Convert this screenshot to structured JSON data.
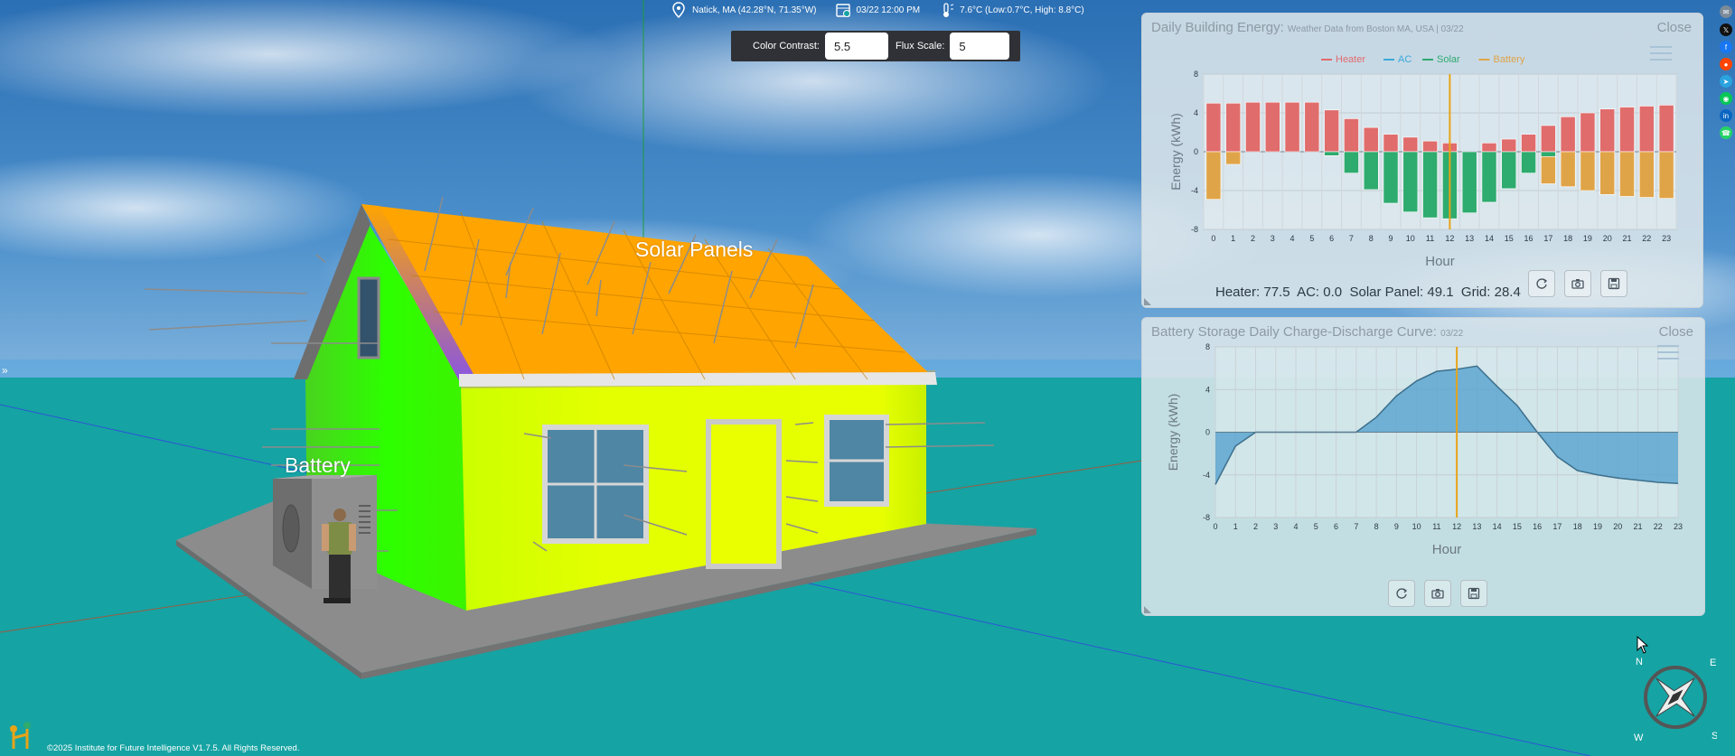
{
  "location": {
    "text": "Natick, MA (42.28°N, 71.35°W)"
  },
  "datetime": {
    "text": "03/22 12:00 PM"
  },
  "weather": {
    "text": "7.6°C (Low:0.7°C, High: 8.8°C)"
  },
  "controls": {
    "color_contrast_label": "Color Contrast:",
    "color_contrast_value": "5.5",
    "flux_scale_label": "Flux Scale:",
    "flux_scale_value": "5"
  },
  "scene_labels": {
    "solar_panels": "Solar Panels",
    "battery": "Battery"
  },
  "sidebar_toggle": "»",
  "energy_panel": {
    "title": "Daily Building Energy:",
    "subtitle": "Weather Data from Boston MA, USA | 03/22",
    "close_label": "Close",
    "summary": {
      "heater_label": "Heater:",
      "heater_value": "77.5",
      "ac_label": "AC:",
      "ac_value": "0.0",
      "solar_label": "Solar Panel:",
      "solar_value": "49.1",
      "grid_label": "Grid:",
      "grid_value": "28.4"
    }
  },
  "battery_panel": {
    "title": "Battery Storage Daily Charge-Discharge Curve:",
    "subtitle": "03/22",
    "close_label": "Close"
  },
  "icons": {
    "location": "map-pin-icon",
    "calendar": "calendar-icon",
    "weather": "thermometer-sun-icon",
    "reload": "reload-icon",
    "camera": "camera-icon",
    "save": "save-icon",
    "menu": "menu-lines-icon"
  },
  "share_links": [
    "email",
    "x",
    "facebook",
    "reddit",
    "telegram",
    "line",
    "linkedin",
    "whatsapp"
  ],
  "compass_letters": {
    "n": "N",
    "e": "E",
    "s": "S",
    "w": "W"
  },
  "footer": {
    "copyright": "©2025 Institute for Future Intelligence V1.7.5. All Rights Reserved."
  },
  "colors": {
    "heater": "#e06c6c",
    "ac": "#3ba9d8",
    "solar": "#2eab6e",
    "battery": "#e0a448",
    "marker": "#e8a317",
    "battery_fill": "#5ea6d0"
  },
  "chart_data": [
    {
      "type": "bar",
      "title": "Daily Building Energy:",
      "xlabel": "Hour",
      "ylabel": "Energy (kWh)",
      "ylim": [
        -8,
        8
      ],
      "yticks": [
        -8,
        -4,
        0,
        4,
        8
      ],
      "categories": [
        "0",
        "1",
        "2",
        "3",
        "4",
        "5",
        "6",
        "7",
        "8",
        "9",
        "10",
        "11",
        "12",
        "13",
        "14",
        "15",
        "16",
        "17",
        "18",
        "19",
        "20",
        "21",
        "22",
        "23"
      ],
      "legend_position": "top-center",
      "marker_hour": 12,
      "grid": true,
      "series": [
        {
          "name": "Heater",
          "values": [
            5.0,
            5.0,
            5.1,
            5.1,
            5.1,
            5.1,
            4.3,
            3.4,
            2.5,
            1.8,
            1.5,
            1.1,
            0.9,
            0.0,
            0.9,
            1.3,
            1.8,
            2.7,
            3.6,
            4.0,
            4.4,
            4.6,
            4.7,
            4.8
          ]
        },
        {
          "name": "AC",
          "values": [
            0,
            0,
            0,
            0,
            0,
            0,
            0,
            0,
            0,
            0,
            0,
            0,
            0,
            0,
            0,
            0,
            0,
            0,
            0,
            0,
            0,
            0,
            0,
            0
          ]
        },
        {
          "name": "Solar",
          "values": [
            0,
            0,
            0,
            0,
            0,
            0,
            -0.4,
            -2.2,
            -3.9,
            -5.3,
            -6.2,
            -6.8,
            -6.9,
            -6.3,
            -5.2,
            -3.8,
            -2.2,
            -0.5,
            0,
            0,
            0,
            0,
            0,
            0
          ]
        },
        {
          "name": "Battery",
          "values": [
            -4.9,
            -1.3,
            0,
            0,
            0,
            0,
            0,
            0,
            0,
            0,
            0,
            0,
            0,
            0,
            0,
            0,
            0,
            -2.8,
            -3.6,
            -4.0,
            -4.4,
            -4.6,
            -4.7,
            -4.8
          ]
        }
      ]
    },
    {
      "type": "area",
      "title": "Battery Storage Daily Charge-Discharge Curve:",
      "xlabel": "Hour",
      "ylabel": "Energy (kWh)",
      "ylim": [
        -8,
        8
      ],
      "yticks": [
        -8,
        -4,
        0,
        4,
        8
      ],
      "x": [
        "0",
        "1",
        "2",
        "3",
        "4",
        "5",
        "6",
        "7",
        "8",
        "9",
        "10",
        "11",
        "12",
        "13",
        "14",
        "15",
        "16",
        "17",
        "18",
        "19",
        "20",
        "21",
        "22",
        "23"
      ],
      "marker_hour": 12,
      "grid": true,
      "values": [
        -4.9,
        -1.3,
        0,
        0,
        0,
        0,
        0,
        0,
        1.4,
        3.4,
        4.8,
        5.7,
        5.9,
        6.2,
        4.3,
        2.5,
        0,
        -2.3,
        -3.6,
        -4.0,
        -4.3,
        -4.5,
        -4.7,
        -4.8
      ]
    }
  ]
}
